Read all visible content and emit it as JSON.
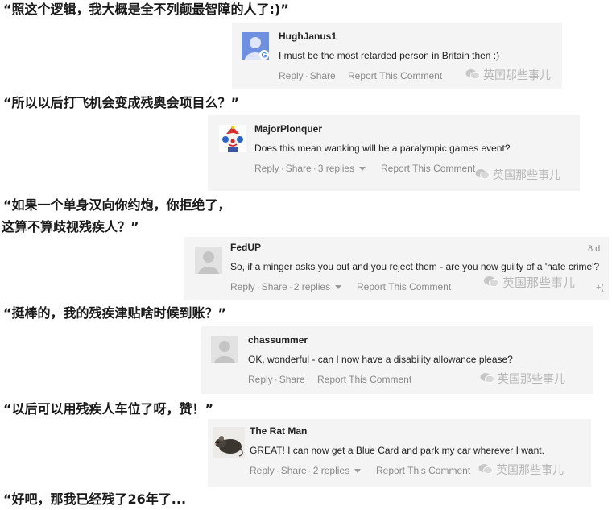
{
  "captions": [
    "“照这个逻辑，我大概是全不列颠最智障的人了:)”",
    "“所以以后打飞机会变成残奥会项目么？”",
    "“如果一个单身汉向你约炮，你拒绝了，",
    "这算不算歧视残疾人？”",
    "“挺棒的，我的残疾津贴啥时候到账？”",
    "“以后可以用残疾人车位了呀，赞！”",
    "“好吧，那我已经残了26年了..."
  ],
  "comments": [
    {
      "username": "HughJanus1",
      "text": "I must be the most retarded person in Britain then :)",
      "reply": "Reply",
      "share": "Share",
      "replies": "",
      "report": "Report This Comment",
      "avatar": "default-avatar-with-g-badge"
    },
    {
      "username": "MajorPlonquer",
      "text": "Does this mean wanking will be a paralympic games event?",
      "reply": "Reply",
      "share": "Share",
      "replies": "3 replies",
      "report": "Report This Comment",
      "avatar": "clown-avatar"
    },
    {
      "username": "FedUP",
      "text": "So, if a minger asks you out and you reject them - are you now guilty of a 'hate crime'?",
      "reply": "Reply",
      "share": "Share",
      "replies": "2 replies",
      "report": "Report This Comment",
      "date": "8 d",
      "plus": "+(",
      "avatar": "default-avatar"
    },
    {
      "username": "chassummer",
      "text": "OK, wonderful - can I now have a disability allowance please?",
      "reply": "Reply",
      "share": "Share",
      "replies": "",
      "report": "Report This Comment",
      "avatar": "default-avatar"
    },
    {
      "username": "The Rat Man",
      "text": "GREAT!  I can now get a Blue Card and park my car wherever I want.",
      "reply": "Reply",
      "share": "Share",
      "replies": "2 replies",
      "report": "Report This Comment",
      "avatar": "rat-avatar"
    }
  ],
  "watermark": "英国那些事儿",
  "colors": {
    "card_bg": "#f4f4f4",
    "avatar_blue": "#6f8fe0",
    "default_avatar": "#d6d6d6",
    "muted_text": "#8a8a8a"
  }
}
